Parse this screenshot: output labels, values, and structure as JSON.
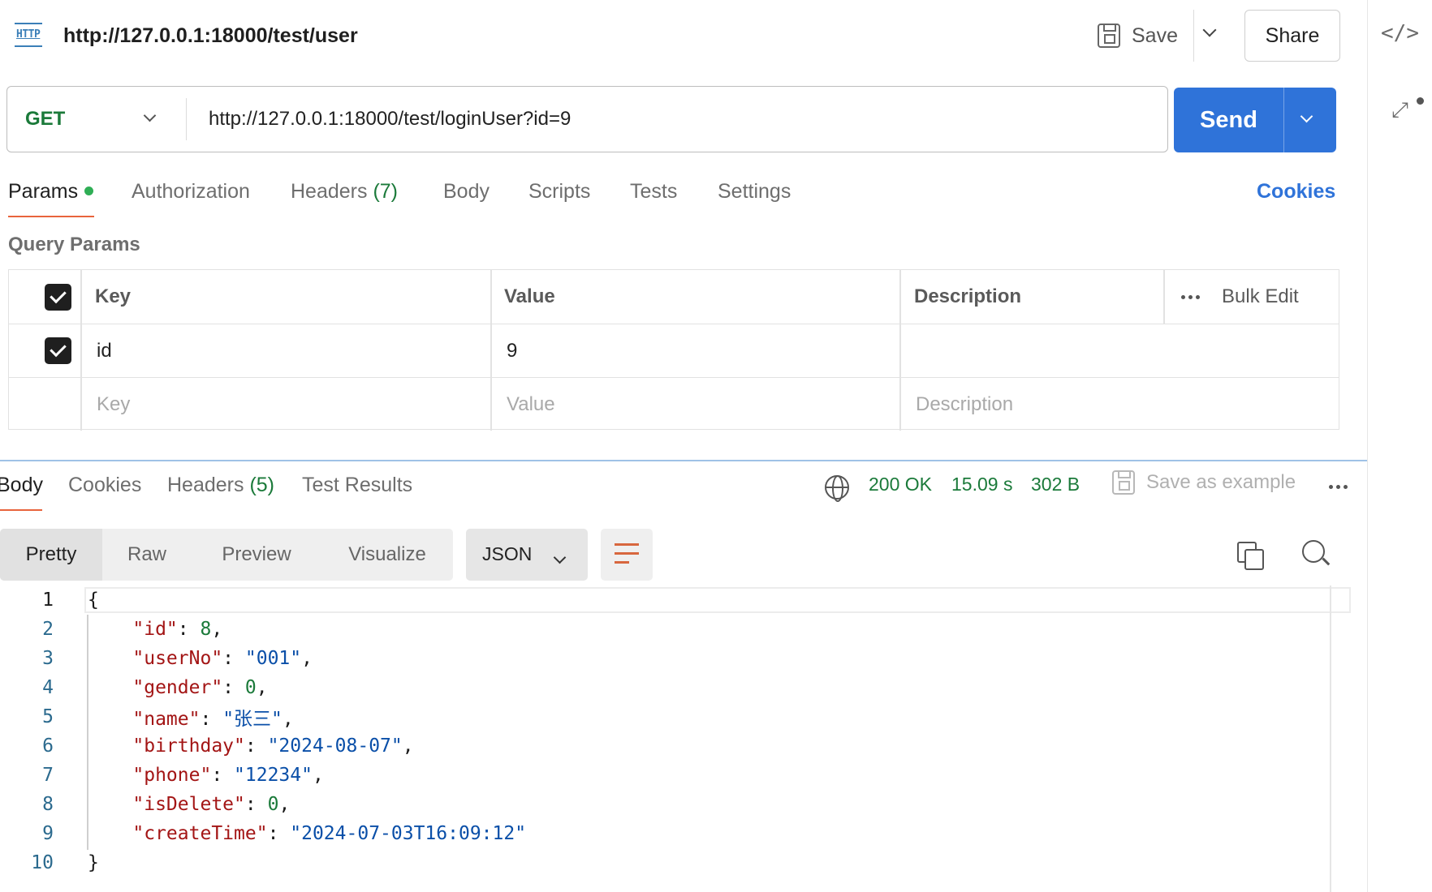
{
  "header": {
    "icon": "http-icon",
    "title": "http://127.0.0.1:18000/test/user",
    "save_label": "Save",
    "share_label": "Share"
  },
  "request": {
    "method": "GET",
    "url": "http://127.0.0.1:18000/test/loginUser?id=9",
    "send_label": "Send"
  },
  "request_tabs": {
    "params": "Params",
    "authorization": "Authorization",
    "headers": "Headers",
    "headers_count": "(7)",
    "body": "Body",
    "scripts": "Scripts",
    "tests": "Tests",
    "settings": "Settings",
    "cookies": "Cookies"
  },
  "query_params": {
    "title": "Query Params",
    "columns": {
      "key": "Key",
      "value": "Value",
      "description": "Description",
      "bulk_edit": "Bulk Edit"
    },
    "rows": [
      {
        "checked": true,
        "key": "id",
        "value": "9",
        "description": ""
      }
    ],
    "placeholders": {
      "key": "Key",
      "value": "Value",
      "description": "Description"
    }
  },
  "response_tabs": {
    "body": "Body",
    "cookies": "Cookies",
    "headers": "Headers",
    "headers_count": "(5)",
    "test_results": "Test Results"
  },
  "response_status": {
    "status": "200 OK",
    "time": "15.09 s",
    "size": "302 B",
    "save_example": "Save as example"
  },
  "view": {
    "modes": [
      "Pretty",
      "Raw",
      "Preview",
      "Visualize"
    ],
    "active_mode": "Pretty",
    "format": "JSON"
  },
  "code_lines": [
    {
      "num": "1",
      "parts": [
        [
          "p",
          "{"
        ]
      ]
    },
    {
      "num": "2",
      "parts": [
        [
          "p",
          "    "
        ],
        [
          "k",
          "\"id\""
        ],
        [
          "p",
          ": "
        ],
        [
          "n",
          "8"
        ],
        [
          "p",
          ","
        ]
      ]
    },
    {
      "num": "3",
      "parts": [
        [
          "p",
          "    "
        ],
        [
          "k",
          "\"userNo\""
        ],
        [
          "p",
          ": "
        ],
        [
          "s",
          "\"001\""
        ],
        [
          "p",
          ","
        ]
      ]
    },
    {
      "num": "4",
      "parts": [
        [
          "p",
          "    "
        ],
        [
          "k",
          "\"gender\""
        ],
        [
          "p",
          ": "
        ],
        [
          "n",
          "0"
        ],
        [
          "p",
          ","
        ]
      ]
    },
    {
      "num": "5",
      "parts": [
        [
          "p",
          "    "
        ],
        [
          "k",
          "\"name\""
        ],
        [
          "p",
          ": "
        ],
        [
          "s",
          "\"张三\""
        ],
        [
          "p",
          ","
        ]
      ]
    },
    {
      "num": "6",
      "parts": [
        [
          "p",
          "    "
        ],
        [
          "k",
          "\"birthday\""
        ],
        [
          "p",
          ": "
        ],
        [
          "s",
          "\"2024-08-07\""
        ],
        [
          "p",
          ","
        ]
      ]
    },
    {
      "num": "7",
      "parts": [
        [
          "p",
          "    "
        ],
        [
          "k",
          "\"phone\""
        ],
        [
          "p",
          ": "
        ],
        [
          "s",
          "\"12234\""
        ],
        [
          "p",
          ","
        ]
      ]
    },
    {
      "num": "8",
      "parts": [
        [
          "p",
          "    "
        ],
        [
          "k",
          "\"isDelete\""
        ],
        [
          "p",
          ": "
        ],
        [
          "n",
          "0"
        ],
        [
          "p",
          ","
        ]
      ]
    },
    {
      "num": "9",
      "parts": [
        [
          "p",
          "    "
        ],
        [
          "k",
          "\"createTime\""
        ],
        [
          "p",
          ": "
        ],
        [
          "s",
          "\"2024-07-03T16:09:12\""
        ]
      ]
    },
    {
      "num": "10",
      "parts": [
        [
          "p",
          "}"
        ]
      ]
    }
  ],
  "colors": {
    "accent": "#2f73d9",
    "method_get": "#1b7a3a",
    "tab_underline": "#e8643c",
    "json_key": "#a31515",
    "json_string": "#0a4fa8",
    "json_number": "#1b7a3a"
  },
  "rightbar": {
    "icons": [
      "code-icon",
      "expand-icon"
    ]
  }
}
